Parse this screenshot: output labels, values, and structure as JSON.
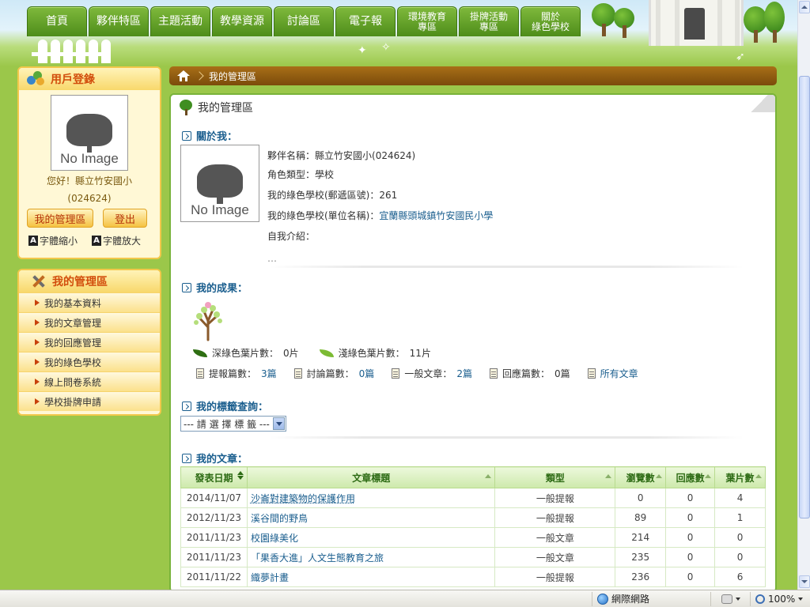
{
  "nav": {
    "tabs": [
      {
        "label": "首頁"
      },
      {
        "label": "夥伴特區"
      },
      {
        "label": "主題活動"
      },
      {
        "label": "教學資源"
      },
      {
        "label": "討論區"
      },
      {
        "label": "電子報"
      },
      {
        "label": "環境教育\n專區"
      },
      {
        "label": "掛牌活動\n專區"
      },
      {
        "label": "關於\n綠色學校"
      }
    ]
  },
  "login": {
    "title": "用戶登錄",
    "avatar_text": "No Image",
    "greeting_line1": "您好！縣立竹安國小",
    "greeting_line2": "(024624)",
    "manage_button": "我的管理區",
    "logout_button": "登出",
    "font_small": "字體縮小",
    "font_large": "字體放大",
    "font_glyph": "A"
  },
  "mgmt": {
    "title": "我的管理區",
    "items": [
      {
        "label": "我的基本資料"
      },
      {
        "label": "我的文章管理"
      },
      {
        "label": "我的回應管理"
      },
      {
        "label": "我的綠色學校"
      },
      {
        "label": "線上問卷系統"
      },
      {
        "label": "學校掛牌申請"
      }
    ]
  },
  "breadcrumb": {
    "current": "我的管理區"
  },
  "main": {
    "title": "我的管理區",
    "about": {
      "heading": "關於我：",
      "avatar_text": "No Image",
      "partner_name_label": "夥伴名稱：",
      "partner_name": "縣立竹安國小(024624)",
      "role_label": "角色類型：",
      "role": "學校",
      "postal_label": "我的綠色學校(郵遞區號)：",
      "postal": "261",
      "unit_label": "我的綠色學校(單位名稱)：",
      "unit": "宜蘭縣頭城鎮竹安國民小學",
      "intro_label": "自我介紹：",
      "intro_ellipsis": "…"
    },
    "results": {
      "heading": "我的成果：",
      "dark_leaf_label": "深綠色葉片數：",
      "dark_leaf_value": "0片",
      "light_leaf_label": "淺綠色葉片數：",
      "light_leaf_value": "11片",
      "counts": [
        {
          "label": "提報篇數：",
          "value": "3篇"
        },
        {
          "label": "討論篇數：",
          "value": "0篇"
        },
        {
          "label": "一般文章：",
          "value": "2篇"
        },
        {
          "label": "回應篇數：",
          "value": "0篇"
        }
      ],
      "all_articles": "所有文章"
    },
    "tags": {
      "heading": "我的標籤查詢：",
      "select_value": "--- 請 選 擇 標 籤 ---"
    },
    "articles": {
      "heading": "我的文章：",
      "columns": [
        "發表日期",
        "文章標題",
        "類型",
        "瀏覽數",
        "回應數",
        "葉片數"
      ],
      "rows": [
        {
          "date": "2014/11/07",
          "title": "沙崙對建築物的保護作用",
          "type": "一般提報",
          "views": "0",
          "replies": "0",
          "leaves": "4"
        },
        {
          "date": "2012/11/23",
          "title": "溪谷間的野鳥",
          "type": "一般提報",
          "views": "89",
          "replies": "0",
          "leaves": "1"
        },
        {
          "date": "2011/11/23",
          "title": "校園綠美化",
          "type": "一般文章",
          "views": "214",
          "replies": "0",
          "leaves": "0"
        },
        {
          "date": "2011/11/23",
          "title": "「果香大進」人文生態教育之旅",
          "type": "一般文章",
          "views": "235",
          "replies": "0",
          "leaves": "0"
        },
        {
          "date": "2011/11/22",
          "title": "織夢計畫",
          "type": "一般提報",
          "views": "236",
          "replies": "0",
          "leaves": "6"
        }
      ]
    }
  },
  "statusbar": {
    "network": "網際網路",
    "zoom": "100%"
  },
  "colors": {
    "page_bg": "#9bc74a",
    "nav_tab": "#5f9d24",
    "sidebar_heading": "#d24d0c",
    "link_blue": "#1a5e8e",
    "breadcrumb_bar": "#8a560f"
  }
}
